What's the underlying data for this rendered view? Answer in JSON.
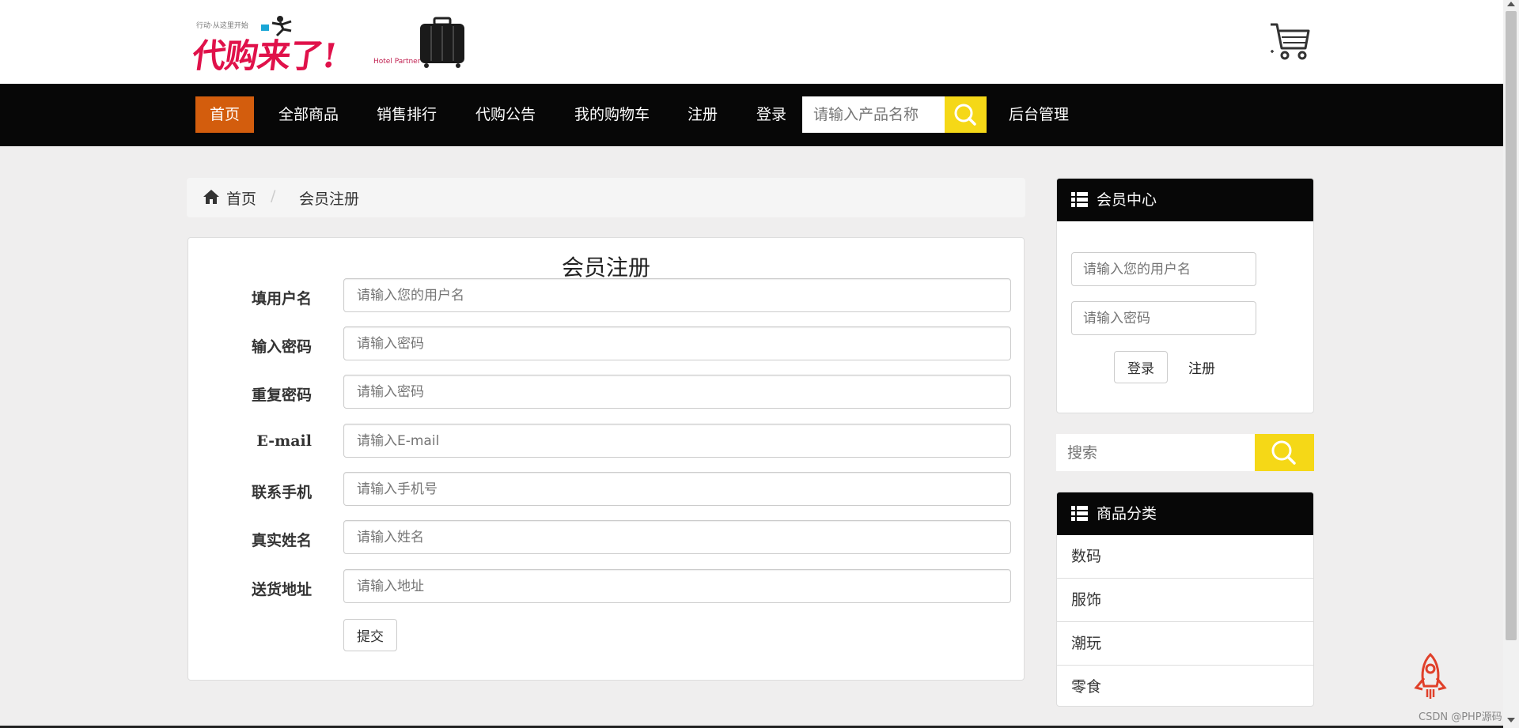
{
  "header": {
    "logo_text": "代购来了!",
    "logo_tagline": "行动·从这里开始",
    "logo_sub": "Hotel Partner",
    "cart_icon": "shopping-cart-icon"
  },
  "nav": {
    "items": [
      {
        "label": "首页",
        "active": true
      },
      {
        "label": "全部商品"
      },
      {
        "label": "销售排行"
      },
      {
        "label": "代购公告"
      },
      {
        "label": "我的购物车"
      },
      {
        "label": "注册"
      },
      {
        "label": "登录"
      }
    ],
    "search_placeholder": "请输入产品名称",
    "search_icon": "search-icon",
    "admin_label": "后台管理"
  },
  "breadcrumb": {
    "home": "首页",
    "separator": "/",
    "current": "会员注册"
  },
  "form": {
    "title": "会员注册",
    "fields": [
      {
        "label": "填用户名",
        "placeholder": "请输入您的用户名"
      },
      {
        "label": "输入密码",
        "placeholder": "请输入密码"
      },
      {
        "label": "重复密码",
        "placeholder": "请输入密码"
      },
      {
        "label": "E-mail",
        "placeholder": "请输入E-mail"
      },
      {
        "label": "联系手机",
        "placeholder": "请输入手机号"
      },
      {
        "label": "真实姓名",
        "placeholder": "请输入姓名"
      },
      {
        "label": "送货地址",
        "placeholder": "请输入地址"
      }
    ],
    "submit_label": "提交"
  },
  "sidebar": {
    "member": {
      "title": "会员中心",
      "username_placeholder": "请输入您的用户名",
      "password_placeholder": "请输入密码",
      "login_label": "登录",
      "register_label": "注册"
    },
    "search_placeholder": "搜索",
    "categories": {
      "title": "商品分类",
      "items": [
        "数码",
        "服饰",
        "潮玩",
        "零食"
      ]
    }
  },
  "watermark": "CSDN @PHP源码",
  "colors": {
    "nav_bg": "#070707",
    "active_nav": "#d35d0d",
    "search_button": "#f5d817",
    "logo_red": "#e0114a",
    "page_bg": "#efeeee"
  }
}
